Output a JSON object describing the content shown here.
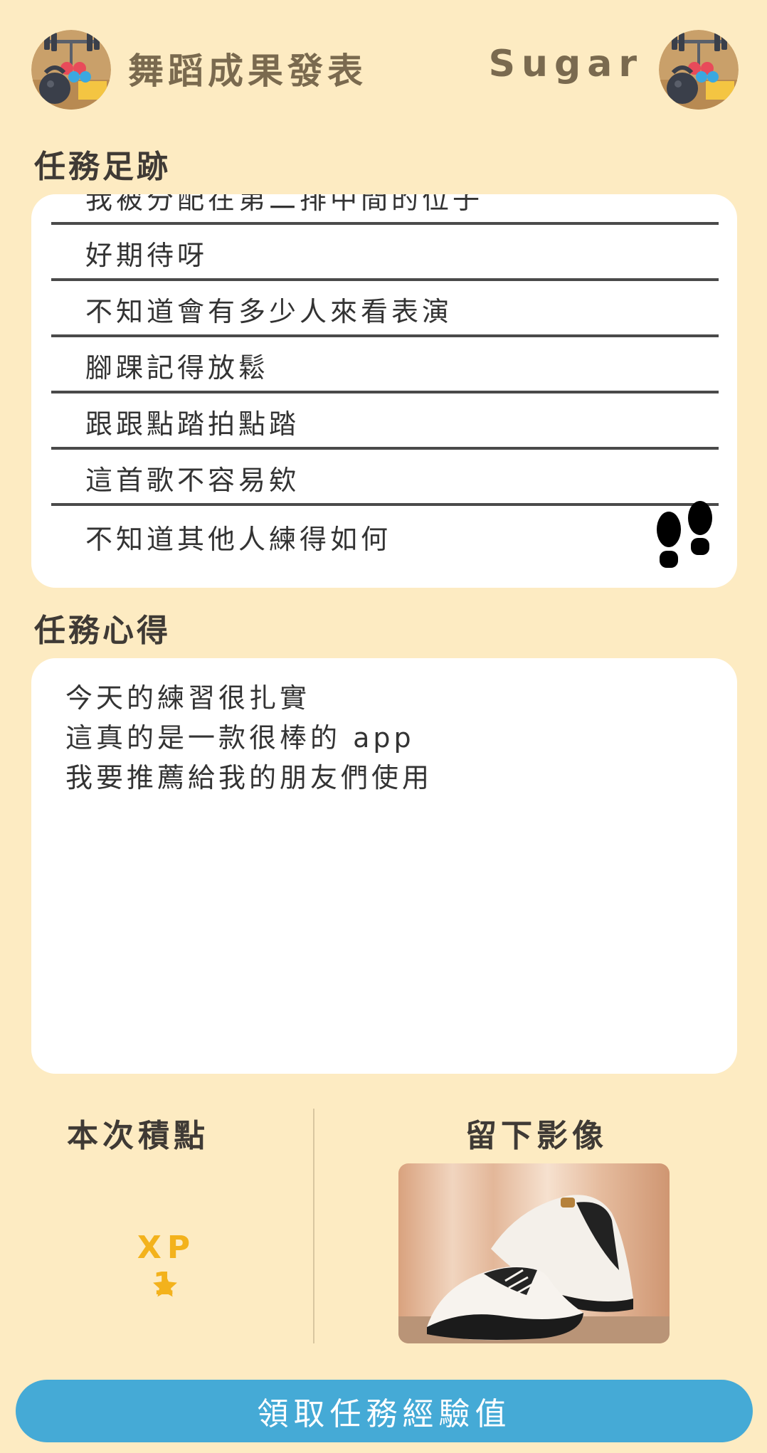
{
  "header": {
    "mission_title": "舞蹈成果發表",
    "user_name": "Sugar",
    "avatar_icon": "fitness-equipment-icon"
  },
  "trace": {
    "heading": "任務足跡",
    "items": [
      "我被分配在第二排中間的位子",
      "好期待呀",
      "不知道會有多少人來看表演",
      "腳踝記得放鬆",
      "跟跟點踏拍點踏",
      "這首歌不容易欸",
      "不知道其他人練得如何"
    ],
    "corner_icon": "footprints-icon"
  },
  "reflection": {
    "heading": "任務心得",
    "lines": [
      "今天的練習很扎實",
      "這真的是一款很棒的 app",
      "我要推薦給我的朋友們使用"
    ]
  },
  "points": {
    "heading": "本次積點",
    "value": "XP 1",
    "icon": "star-icon",
    "accent": "#F3B21C"
  },
  "image_section": {
    "heading": "留下影像",
    "photo": "tap-shoes-photo"
  },
  "action": {
    "claim_label": "領取任務經驗值",
    "color": "#45AAD6"
  },
  "colors": {
    "background": "#FDEBC2",
    "card": "#FFFFFF"
  }
}
